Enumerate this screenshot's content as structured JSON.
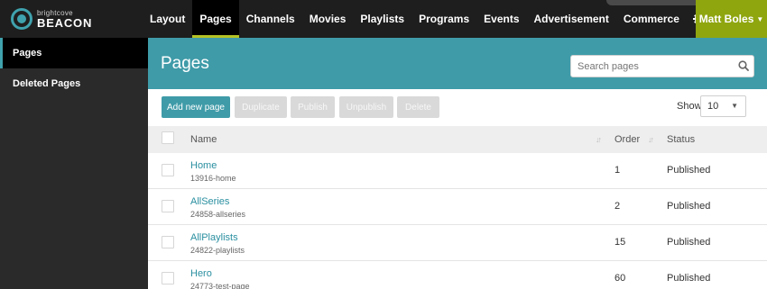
{
  "brand": {
    "small": "brightcove",
    "big": "BEACON"
  },
  "nav": {
    "items": [
      {
        "label": "Layout",
        "active": false
      },
      {
        "label": "Pages",
        "active": true
      },
      {
        "label": "Channels",
        "active": false
      },
      {
        "label": "Movies",
        "active": false
      },
      {
        "label": "Playlists",
        "active": false
      },
      {
        "label": "Programs",
        "active": false
      },
      {
        "label": "Events",
        "active": false
      },
      {
        "label": "Advertisement",
        "active": false
      },
      {
        "label": "Commerce",
        "active": false
      }
    ],
    "icons": [
      "gear-icon",
      "wrench-icon"
    ],
    "user": "Matt Boles"
  },
  "sidebar": {
    "items": [
      {
        "label": "Pages",
        "active": true
      },
      {
        "label": "Deleted Pages",
        "active": false
      }
    ]
  },
  "main": {
    "title": "Pages",
    "search": {
      "placeholder": "Search pages",
      "value": ""
    },
    "toolbar": {
      "add_label": "Add new page",
      "duplicate_label": "Duplicate",
      "publish_label": "Publish",
      "unpublish_label": "Unpublish",
      "delete_label": "Delete",
      "show_label": "Show",
      "show_value": "10"
    },
    "table": {
      "headers": {
        "name": "Name",
        "order": "Order",
        "status": "Status"
      },
      "rows": [
        {
          "name": "Home",
          "slug": "13916-home",
          "order": "1",
          "status": "Published"
        },
        {
          "name": "AllSeries",
          "slug": "24858-allseries",
          "order": "2",
          "status": "Published"
        },
        {
          "name": "AllPlaylists",
          "slug": "24822-playlists",
          "order": "15",
          "status": "Published"
        },
        {
          "name": "Hero",
          "slug": "24773-test-page",
          "order": "60",
          "status": "Published"
        }
      ]
    }
  },
  "colors": {
    "accent": "#3f9ba8",
    "nav_bg": "#1e1e1e",
    "user_bg": "#8fa60f",
    "active_underline": "#b5c225"
  }
}
